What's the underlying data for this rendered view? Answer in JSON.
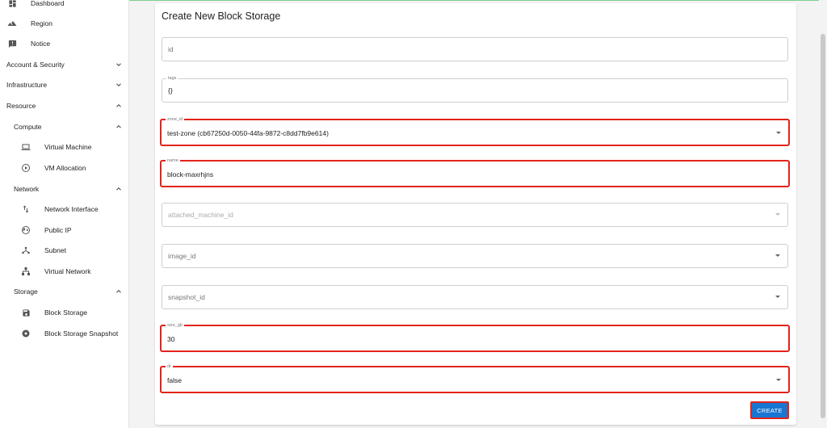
{
  "sidebar": {
    "items": [
      {
        "label": "Dashboard",
        "icon": "dashboard-icon"
      },
      {
        "label": "Region",
        "icon": "terrain-icon"
      },
      {
        "label": "Notice",
        "icon": "announcement-icon"
      },
      {
        "label": "Account & Security",
        "expanded": false
      },
      {
        "label": "Infrastructure",
        "expanded": false
      },
      {
        "label": "Resource",
        "expanded": true
      },
      {
        "label": "Compute",
        "expanded": true
      },
      {
        "label": "Virtual Machine",
        "icon": "laptop-icon"
      },
      {
        "label": "VM Allocation",
        "icon": "play-circle-icon"
      },
      {
        "label": "Network",
        "expanded": true
      },
      {
        "label": "Network Interface",
        "icon": "swap-vert-icon"
      },
      {
        "label": "Public IP",
        "icon": "globe-icon"
      },
      {
        "label": "Subnet",
        "icon": "subnet-icon"
      },
      {
        "label": "Virtual Network",
        "icon": "hierarchy-icon"
      },
      {
        "label": "Storage",
        "expanded": true
      },
      {
        "label": "Block Storage",
        "icon": "save-icon"
      },
      {
        "label": "Block Storage Snapshot",
        "icon": "disc-icon"
      }
    ]
  },
  "form": {
    "title": "Create New Block Storage",
    "fields": [
      {
        "name": "id",
        "placeholder": "id",
        "value": ""
      },
      {
        "name": "tags",
        "label": "tags",
        "value": "{}"
      },
      {
        "name": "zone_id",
        "label": "zone_id",
        "value": "test-zone (cb67250d-0050-44fa-9872-c8dd7fb9e614)"
      },
      {
        "name": "name",
        "label": "name",
        "value": "block-maxrhjns"
      },
      {
        "name": "attached_machine_id",
        "placeholder": "attached_machine_id",
        "value": ""
      },
      {
        "name": "image_id",
        "placeholder": "image_id",
        "value": ""
      },
      {
        "name": "snapshot_id",
        "placeholder": "snapshot_id",
        "value": ""
      },
      {
        "name": "size_gb",
        "label": "size_gb",
        "value": "30"
      },
      {
        "name": "dr",
        "label": "dr",
        "value": "false"
      }
    ],
    "create_label": "CREATE"
  },
  "colors": {
    "accent": "#1976d2",
    "highlight": "#e2231a"
  }
}
